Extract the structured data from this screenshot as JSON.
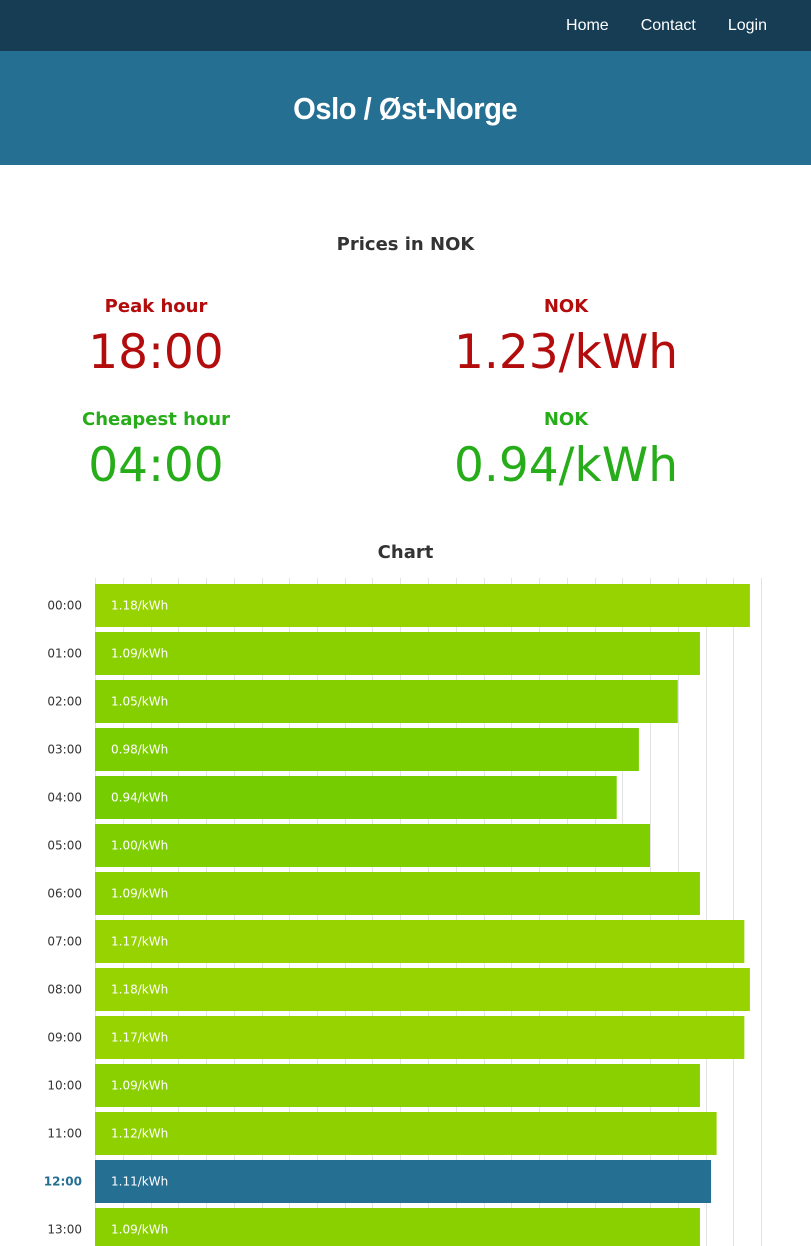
{
  "nav": {
    "home": "Home",
    "contact": "Contact",
    "login": "Login"
  },
  "hero": {
    "title": "Oslo / Øst-Norge"
  },
  "prices": {
    "title": "Prices in NOK",
    "peak": {
      "label": "Peak hour",
      "hour": "18:00",
      "unit_label": "NOK",
      "price": "1.23/kWh"
    },
    "cheapest": {
      "label": "Cheapest hour",
      "hour": "04:00",
      "unit_label": "NOK",
      "price": "0.94/kWh"
    }
  },
  "colors": {
    "peak": "#b30c0c",
    "cheap": "#27ad1a",
    "current": "#256f93",
    "navbar": "#173d55",
    "hero": "#256f93"
  },
  "chart_title": "Chart",
  "chart_data": {
    "type": "bar",
    "orientation": "horizontal",
    "title": "Chart",
    "xlabel": "",
    "ylabel": "",
    "categories": [
      "00:00",
      "01:00",
      "02:00",
      "03:00",
      "04:00",
      "05:00",
      "06:00",
      "07:00",
      "08:00",
      "09:00",
      "10:00",
      "11:00",
      "12:00",
      "13:00"
    ],
    "values": [
      1.18,
      1.09,
      1.05,
      0.98,
      0.94,
      1.0,
      1.09,
      1.17,
      1.18,
      1.17,
      1.09,
      1.12,
      1.11,
      1.09
    ],
    "labels": [
      "1.18/kWh",
      "1.09/kWh",
      "1.05/kWh",
      "0.98/kWh",
      "0.94/kWh",
      "1.00/kWh",
      "1.09/kWh",
      "1.17/kWh",
      "1.18/kWh",
      "1.17/kWh",
      "1.09/kWh",
      "1.12/kWh",
      "1.11/kWh",
      "1.09/kWh"
    ],
    "highlighted_category": "12:00",
    "xlim": [
      0,
      1.2
    ],
    "grid": true,
    "legend": "none"
  }
}
